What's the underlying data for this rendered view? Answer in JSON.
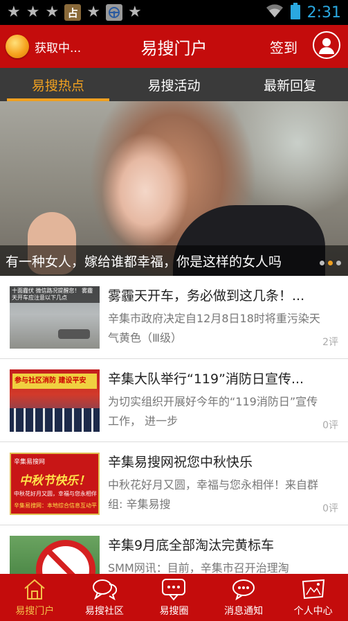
{
  "status_bar": {
    "notification_icons": [
      "star-icon",
      "star-icon",
      "star-icon",
      "fortune-app-icon",
      "star-icon",
      "steering-app-icon",
      "star-icon"
    ],
    "fortune_glyph": "占",
    "time": "2:31",
    "clock_color": "#2aa8e0"
  },
  "header": {
    "weather_text": "获取中...",
    "title": "易搜门户",
    "signin_label": "签到",
    "background": "#c40c0c"
  },
  "tabs": [
    {
      "label": "易搜热点",
      "active": true
    },
    {
      "label": "易搜活动",
      "active": false
    },
    {
      "label": "最新回复",
      "active": false
    }
  ],
  "banner": {
    "caption": "有一种女人，嫁给谁都幸福，你是这样的女人吗",
    "slide_count": 3,
    "active_slide": 2
  },
  "news": [
    {
      "title": "雾霾天开车，务必做到这几条！...",
      "summary": "辛集市政府决定自12月8日18时将重污染天气黄色（Ⅲ级）",
      "comments": "2评",
      "thumb_text": "十面霾伏 微信路况提醒您！ 雾霾天开车应注意以下几点"
    },
    {
      "title": "辛集大队举行“119”消防日宣传...",
      "summary": "为切实组织开展好今年的“119消防日”宣传工作， 进一步",
      "comments": "0评",
      "thumb_text": "参与社区消防 建设平安"
    },
    {
      "title": "辛集易搜网祝您中秋快乐",
      "summary": "中秋花好月又圆，幸福与您永相伴！来自群组: 辛集易搜",
      "comments": "0评",
      "thumb_title": "辛集易搜网",
      "thumb_text": "中秋节快乐！",
      "thumb_sub": "中秋花好月又圆，幸福与您永相伴",
      "thumb_footer": "辛集易搜网：本地综合信息互动平台"
    },
    {
      "title": "辛集9月底全部淘汰完黄标车",
      "summary": "SMM网讯：目前，辛集市召开治理淘",
      "comments": ""
    }
  ],
  "bottom_nav": [
    {
      "label": "易搜门户",
      "icon": "home-icon",
      "active": true
    },
    {
      "label": "易搜社区",
      "icon": "chat-bubbles-icon",
      "active": false
    },
    {
      "label": "易搜圈",
      "icon": "chat-dots-icon",
      "active": false
    },
    {
      "label": "消息通知",
      "icon": "message-icon",
      "active": false
    },
    {
      "label": "个人中心",
      "icon": "flag-icon",
      "active": false
    }
  ],
  "colors": {
    "brand_red": "#c40c0c",
    "accent_orange": "#f0a020",
    "tab_bar": "#3a3a3a",
    "nav_active": "#f3c14a"
  }
}
